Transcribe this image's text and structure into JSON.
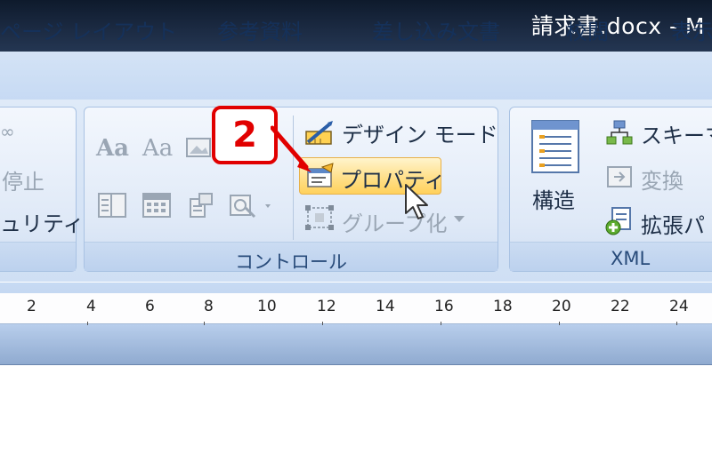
{
  "window": {
    "title": "請求書.docx - M"
  },
  "tabs": [
    "ページ レイアウト",
    "参考資料",
    "差し込み文書",
    "校閲",
    "表示"
  ],
  "ribbon": {
    "left_group": {
      "items": [
        "停止",
        "ュリティ"
      ]
    },
    "controls_group": {
      "label": "コントロール",
      "font_button_1": "Aa",
      "font_button_2": "Aa",
      "design_mode": "デザイン モード",
      "properties": "プロパティ",
      "group": "グループ化"
    },
    "xml_group": {
      "label": "XML",
      "structure": "構造",
      "schema": "スキーマ",
      "transform": "変換",
      "expansion": "拡張パ"
    }
  },
  "ruler": {
    "ticks": [
      "2",
      "4",
      "6",
      "8",
      "10",
      "12",
      "14",
      "16",
      "18",
      "20",
      "22",
      "24"
    ]
  },
  "callout": {
    "number": "2",
    "color": "#e10000"
  },
  "icons": [
    "design-mode-icon",
    "properties-icon",
    "group-icon",
    "structure-icon",
    "schema-icon",
    "transform-icon",
    "expansion-icon",
    "mouse-cursor-icon"
  ]
}
